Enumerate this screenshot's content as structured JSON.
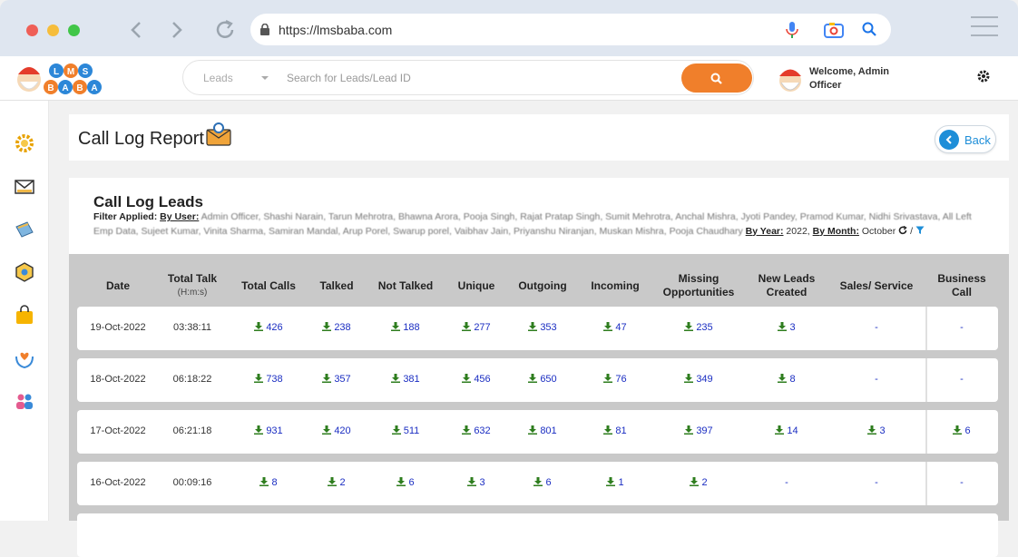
{
  "browser": {
    "url": "https://lmsbaba.com"
  },
  "header": {
    "search_select": "Leads",
    "search_placeholder": "Search for Leads/Lead ID",
    "welcome_line1": "Welcome, Admin",
    "welcome_line2": "Officer",
    "logo_text": "LMS BABA"
  },
  "page": {
    "title": "Call Log Report",
    "back_label": "Back"
  },
  "report": {
    "heading": "Call Log Leads",
    "filter_label": "Filter Applied:",
    "by_user_label": "By User:",
    "users": "Admin Officer, Shashi Narain, Tarun Mehrotra, Bhawna Arora, Pooja Singh, Rajat Pratap Singh, Sumit Mehrotra, Anchal Mishra, Jyoti Pandey, Pramod Kumar, Nidhi Srivastava, All Left Emp Data, Sujeet Kumar, Vinita Sharma, Samiran Mandal, Arup Porel, Swarup porel, Vaibhav Jain, Priyanshu Niranjan, Muskan Mishra, Pooja Chaudhary",
    "by_year_label": "By Year:",
    "year": "2022,",
    "by_month_label": "By Month:",
    "month": "October"
  },
  "table": {
    "columns": [
      {
        "line1": "Date",
        "line2": ""
      },
      {
        "line1": "Total Talk",
        "line2": "(H:m:s)"
      },
      {
        "line1": "Total Calls",
        "line2": ""
      },
      {
        "line1": "Talked",
        "line2": ""
      },
      {
        "line1": "Not Talked",
        "line2": ""
      },
      {
        "line1": "Unique",
        "line2": ""
      },
      {
        "line1": "Outgoing",
        "line2": ""
      },
      {
        "line1": "Incoming",
        "line2": ""
      },
      {
        "line1": "Missing",
        "line2": "Opportunities"
      },
      {
        "line1": "New Leads",
        "line2": "Created"
      },
      {
        "line1": "Sales/ Service",
        "line2": ""
      },
      {
        "line1": "Business",
        "line2": "Call"
      }
    ],
    "rows": [
      [
        "19-Oct-2022",
        "03:38:11",
        "426",
        "238",
        "188",
        "277",
        "353",
        "47",
        "235",
        "3",
        "-",
        "-"
      ],
      [
        "18-Oct-2022",
        "06:18:22",
        "738",
        "357",
        "381",
        "456",
        "650",
        "76",
        "349",
        "8",
        "-",
        "-"
      ],
      [
        "17-Oct-2022",
        "06:21:18",
        "931",
        "420",
        "511",
        "632",
        "801",
        "81",
        "397",
        "14",
        "3",
        "6"
      ],
      [
        "16-Oct-2022",
        "00:09:16",
        "8",
        "2",
        "6",
        "3",
        "6",
        "1",
        "2",
        "-",
        "-",
        "-"
      ]
    ]
  },
  "colors": {
    "accent_orange": "#f07f2b",
    "link_blue": "#1a2dc2",
    "download_green": "#2e7d1e",
    "back_blue": "#1e8ed8"
  }
}
